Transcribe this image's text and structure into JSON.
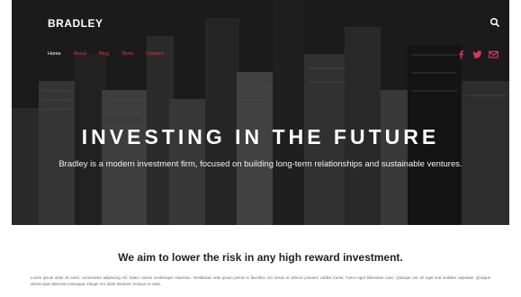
{
  "header": {
    "brand": "BRADLEY",
    "search_icon": "search-icon",
    "nav": [
      {
        "label": "Home",
        "active": true
      },
      {
        "label": "About",
        "active": false
      },
      {
        "label": "Blog",
        "active": false
      },
      {
        "label": "Store",
        "active": false
      },
      {
        "label": "Contact",
        "active": false
      }
    ],
    "social_icons": [
      "facebook-icon",
      "twitter-icon",
      "mail-icon"
    ]
  },
  "hero": {
    "title": "INVESTING IN THE FUTURE",
    "subtitle": "Bradley is a modern investment firm, focused on building long-term relationships and sustainable ventures."
  },
  "content": {
    "tagline": "We aim to lower the risk in any high reward investment.",
    "paragraph": "Lorem ipsum dolor sit amet, consectetur adipiscing elit. Etiam cursus scelerisque maximus. Vestibulum ante ipsum primis in faucibus orci luctus et ultrices posuere cubilia Curae; Fusce eget bibendum nunc. Quisque nec mi eget erat sodales vulputate. Quisque ullamcorper placerat consequat. Integer nec diam tincidunt, tempus ex vitae,"
  },
  "colors": {
    "accent": "#e0355b",
    "hero_text": "#ffffff",
    "heading_text": "#222222",
    "body_text": "#666666"
  }
}
